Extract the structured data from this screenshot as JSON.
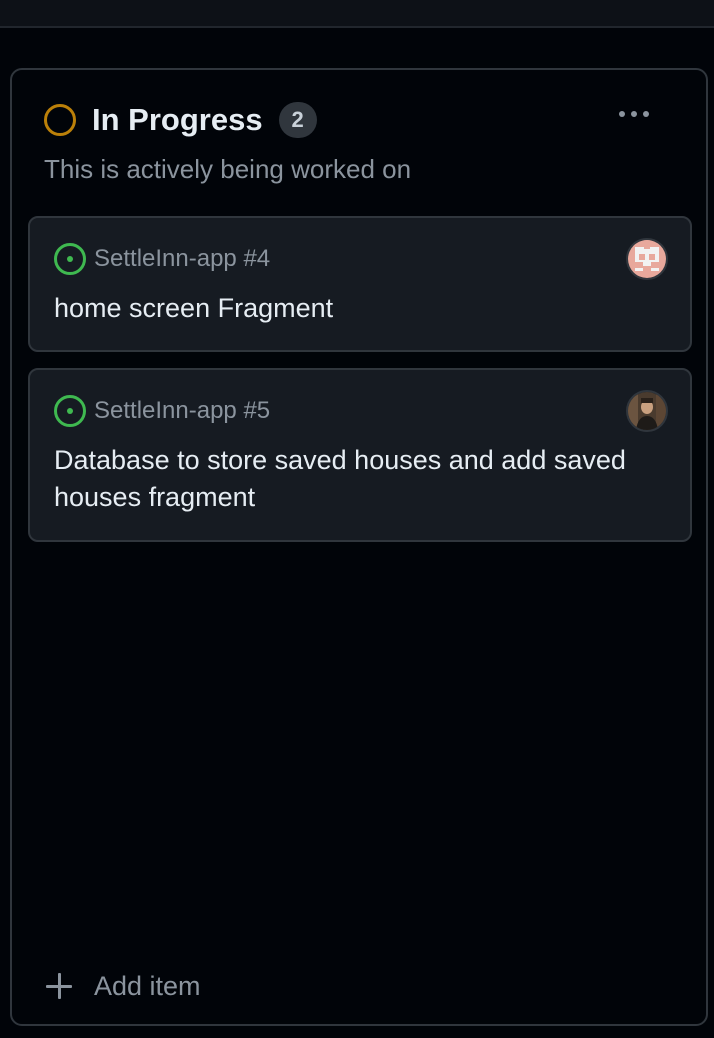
{
  "column": {
    "title": "In Progress",
    "count": "2",
    "description": "This is actively being worked on",
    "status_color": "#bb8009",
    "more_icon": "kebab-horizontal-icon"
  },
  "cards": [
    {
      "repo_ref": "SettleInn-app #4",
      "title": "home screen Fragment",
      "status_icon": "issue-opened-icon",
      "status_color": "#3fb950",
      "avatar": "identicon-avatar"
    },
    {
      "repo_ref": "SettleInn-app #5",
      "title": "Database to store saved houses and add saved houses fragment",
      "status_icon": "issue-opened-icon",
      "status_color": "#3fb950",
      "avatar": "photo-avatar"
    }
  ],
  "footer": {
    "add_item_label": "Add item",
    "add_icon": "plus-icon"
  }
}
